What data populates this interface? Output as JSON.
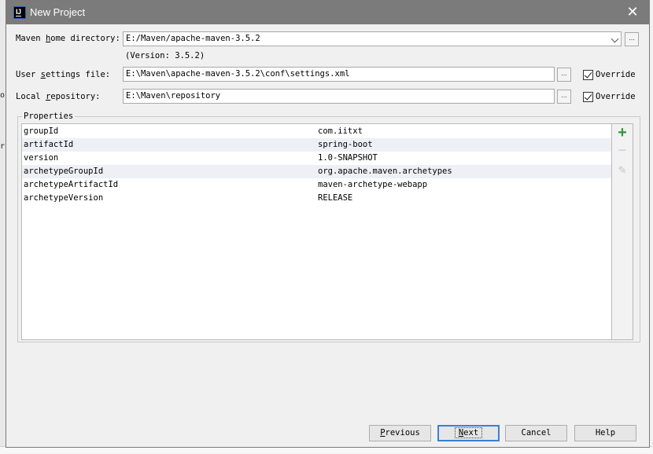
{
  "window": {
    "title": "New Project",
    "icon": "intellij-icon",
    "icon_text": "IJ"
  },
  "form": {
    "maven_home": {
      "label_pre": "Maven ",
      "label_mnemonic": "h",
      "label_post": "ome directory:",
      "value": "E:/Maven/apache-maven-3.5.2",
      "version": "(Version: 3.5.2)"
    },
    "user_settings": {
      "label_pre": "User ",
      "label_mnemonic": "s",
      "label_post": "ettings file:",
      "value": "E:\\Maven\\apache-maven-3.5.2\\conf\\settings.xml",
      "browse": "...",
      "override_label": "Override",
      "override_checked": true
    },
    "local_repository": {
      "label_pre": "Local ",
      "label_mnemonic": "r",
      "label_post": "epository:",
      "value": "E:\\Maven\\repository",
      "browse": "...",
      "override_label": "Override",
      "override_checked": true
    },
    "browse_maven": "..."
  },
  "properties": {
    "title": "Properties",
    "rows": [
      {
        "key": "groupId",
        "value": "com.iitxt"
      },
      {
        "key": "artifactId",
        "value": "spring-boot"
      },
      {
        "key": "version",
        "value": "1.0-SNAPSHOT"
      },
      {
        "key": "archetypeGroupId",
        "value": "org.apache.maven.archetypes"
      },
      {
        "key": "archetypeArtifactId",
        "value": "maven-archetype-webapp"
      },
      {
        "key": "archetypeVersion",
        "value": "RELEASE"
      }
    ],
    "toolbar": {
      "add": "+",
      "remove": "−",
      "edit": "✎"
    }
  },
  "buttons": {
    "previous": {
      "mnemonic": "P",
      "rest": "revious"
    },
    "next": {
      "mnemonic": "N",
      "rest": "ext"
    },
    "cancel": "Cancel",
    "help": "Help"
  },
  "background": {
    "frag_left_1": "r",
    "frag_left_2": "ol"
  },
  "colors": {
    "titlebar": "#7b7b7b",
    "add_icon": "#2e9a3c",
    "default_button_border": "#3c7fd6"
  }
}
